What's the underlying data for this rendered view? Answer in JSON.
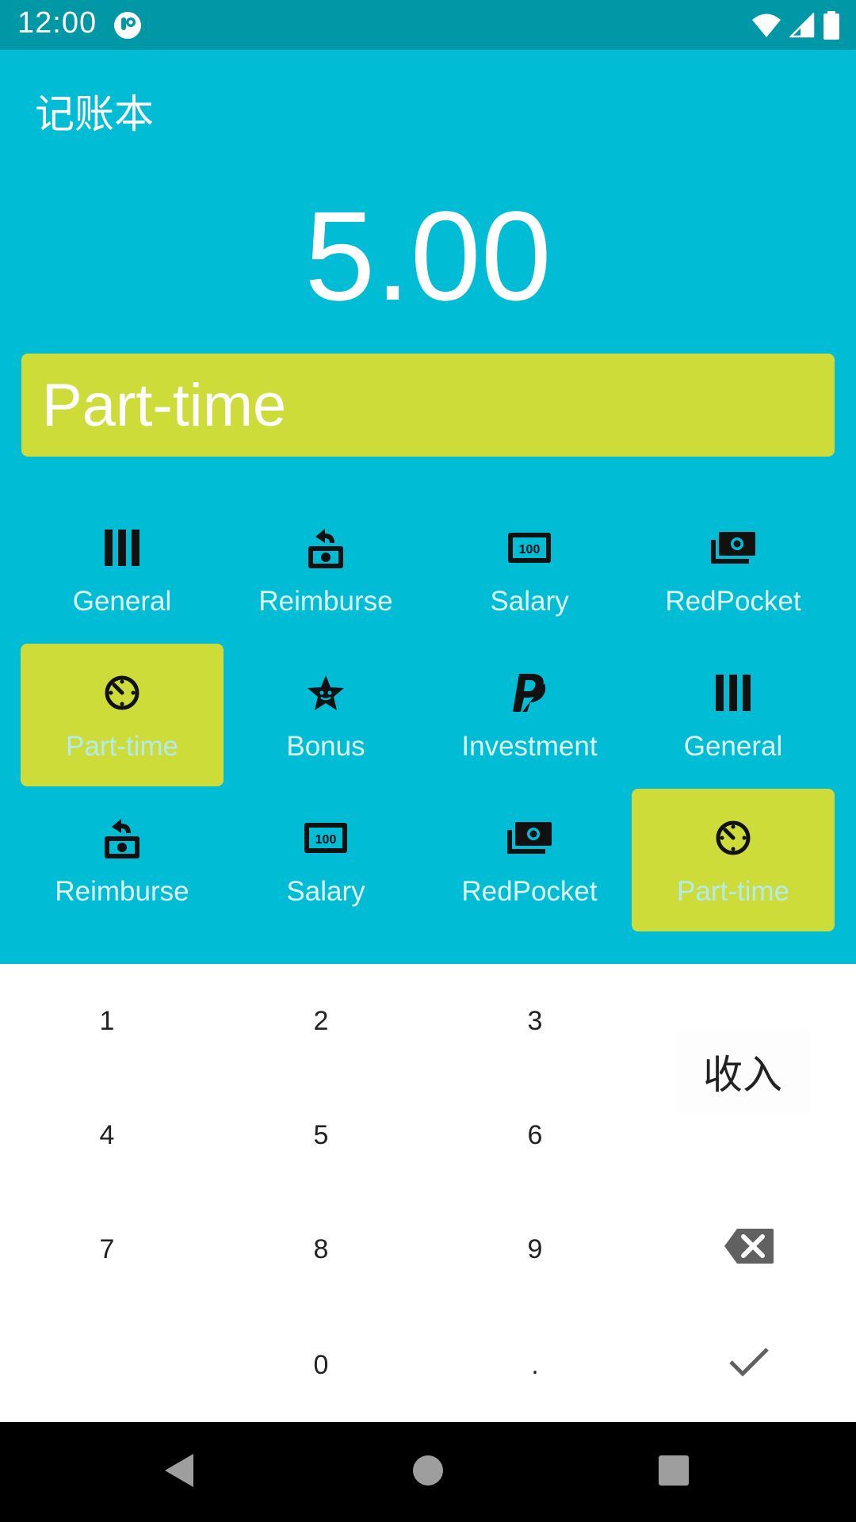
{
  "status_bar": {
    "time": "12:00",
    "icons": [
      "app-notification-icon",
      "wifi-icon",
      "cellular-signal-icon",
      "battery-icon"
    ]
  },
  "app": {
    "title": "记账本"
  },
  "amount": "5.00",
  "selected_category": "Part-time",
  "categories": [
    {
      "label": "General",
      "icon": "general-icon",
      "selected": false
    },
    {
      "label": "Reimburse",
      "icon": "reimburse-icon",
      "selected": false
    },
    {
      "label": "Salary",
      "icon": "salary-icon",
      "selected": false
    },
    {
      "label": "RedPocket",
      "icon": "redpocket-icon",
      "selected": false
    },
    {
      "label": "Part-time",
      "icon": "timer-icon",
      "selected": true
    },
    {
      "label": "Bonus",
      "icon": "bonus-star-icon",
      "selected": false
    },
    {
      "label": "Investment",
      "icon": "paypal-icon",
      "selected": false
    },
    {
      "label": "General",
      "icon": "general-icon",
      "selected": false
    },
    {
      "label": "Reimburse",
      "icon": "reimburse-icon",
      "selected": false
    },
    {
      "label": "Salary",
      "icon": "salary-icon",
      "selected": false
    },
    {
      "label": "RedPocket",
      "icon": "redpocket-icon",
      "selected": false
    },
    {
      "label": "Part-time",
      "icon": "timer-icon",
      "selected": true
    }
  ],
  "keypad": {
    "k1": "1",
    "k2": "2",
    "k3": "3",
    "k4": "4",
    "k5": "5",
    "k6": "6",
    "k7": "7",
    "k8": "8",
    "k9": "9",
    "k0": "0",
    "dot": ".",
    "type_button": "收入",
    "icons": [
      "backspace-icon",
      "check-icon"
    ]
  },
  "nav_bar": {
    "icons": [
      "back-icon",
      "home-icon",
      "recents-icon"
    ]
  },
  "colors": {
    "primary": "#00BCD4",
    "primary_dark": "#0097A7",
    "accent": "#CDDC39"
  }
}
